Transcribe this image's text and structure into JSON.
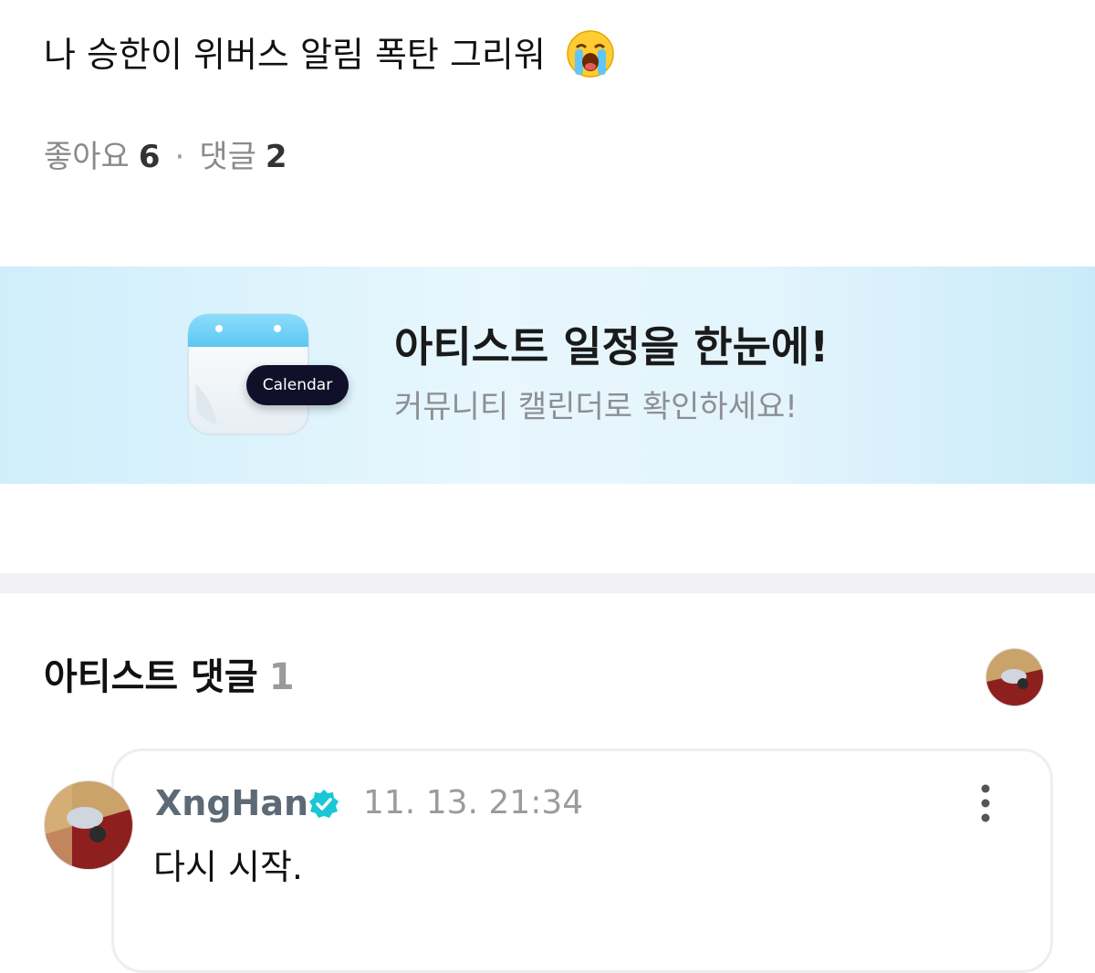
{
  "post": {
    "text": "나 승한이 위버스 알림 폭탄 그리워",
    "emoji": "loudly-crying-face-icon"
  },
  "stats": {
    "likes_label": "좋아요",
    "likes_count": "6",
    "separator": "·",
    "comments_label": "댓글",
    "comments_count": "2"
  },
  "banner": {
    "icon": "calendar-icon",
    "icon_pill": "Calendar",
    "title": "아티스트 일정을 한눈에!",
    "subtitle": "커뮤니티 캘린더로 확인하세요!",
    "colors": {
      "pill_bg": "#10102a",
      "banner_bg": "#e3f4fc"
    }
  },
  "artist_comments": {
    "title": "아티스트 댓글",
    "count": "1",
    "comment": {
      "author": "XngHan",
      "timestamp": "11. 13. 21:34",
      "text": "다시 시작.",
      "verified_color": "#19c7d6"
    }
  }
}
